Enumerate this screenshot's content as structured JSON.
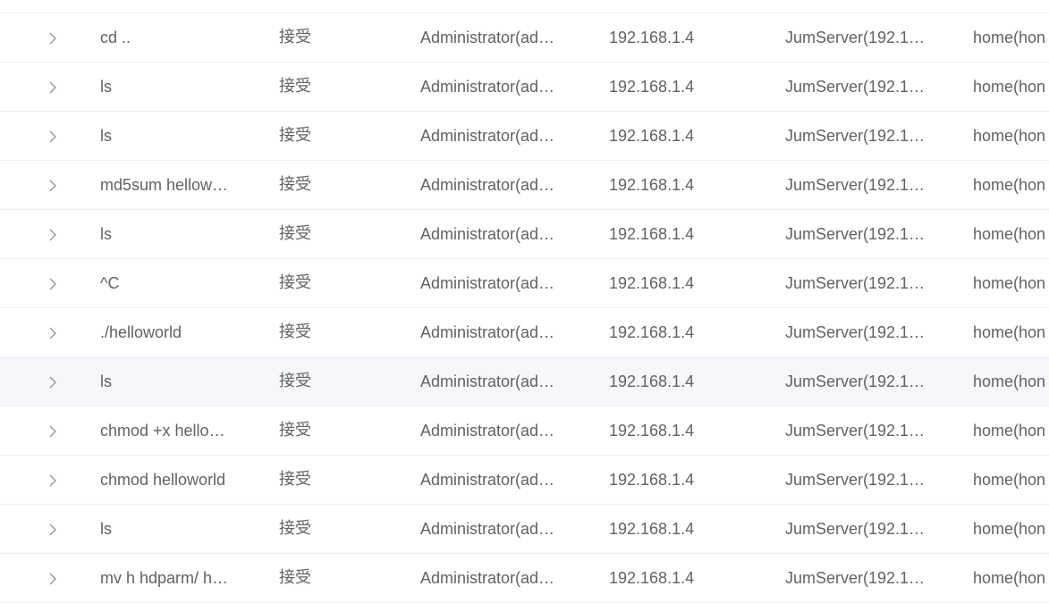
{
  "table": {
    "rows": [
      {
        "command": "",
        "risk": "",
        "user": "",
        "ip": "",
        "asset": "",
        "account": ""
      },
      {
        "command": "cd ..",
        "risk": "接受",
        "user": "Administrator(ad…",
        "ip": "192.168.1.4",
        "asset": "JumServer(192.1…",
        "account": "home(hon"
      },
      {
        "command": "ls",
        "risk": "接受",
        "user": "Administrator(ad…",
        "ip": "192.168.1.4",
        "asset": "JumServer(192.1…",
        "account": "home(hon"
      },
      {
        "command": "ls",
        "risk": "接受",
        "user": "Administrator(ad…",
        "ip": "192.168.1.4",
        "asset": "JumServer(192.1…",
        "account": "home(hon"
      },
      {
        "command": "md5sum hellow…",
        "risk": "接受",
        "user": "Administrator(ad…",
        "ip": "192.168.1.4",
        "asset": "JumServer(192.1…",
        "account": "home(hon"
      },
      {
        "command": "ls",
        "risk": "接受",
        "user": "Administrator(ad…",
        "ip": "192.168.1.4",
        "asset": "JumServer(192.1…",
        "account": "home(hon"
      },
      {
        "command": "^C",
        "risk": "接受",
        "user": "Administrator(ad…",
        "ip": "192.168.1.4",
        "asset": "JumServer(192.1…",
        "account": "home(hon"
      },
      {
        "command": "./helloworld",
        "risk": "接受",
        "user": "Administrator(ad…",
        "ip": "192.168.1.4",
        "asset": "JumServer(192.1…",
        "account": "home(hon"
      },
      {
        "command": "ls",
        "risk": "接受",
        "user": "Administrator(ad…",
        "ip": "192.168.1.4",
        "asset": "JumServer(192.1…",
        "account": "home(hon"
      },
      {
        "command": "chmod +x hello…",
        "risk": "接受",
        "user": "Administrator(ad…",
        "ip": "192.168.1.4",
        "asset": "JumServer(192.1…",
        "account": "home(hon"
      },
      {
        "command": "chmod helloworld",
        "risk": "接受",
        "user": "Administrator(ad…",
        "ip": "192.168.1.4",
        "asset": "JumServer(192.1…",
        "account": "home(hon"
      },
      {
        "command": "ls",
        "risk": "接受",
        "user": "Administrator(ad…",
        "ip": "192.168.1.4",
        "asset": "JumServer(192.1…",
        "account": "home(hon"
      },
      {
        "command": "mv h hdparm/ h…",
        "risk": "接受",
        "user": "Administrator(ad…",
        "ip": "192.168.1.4",
        "asset": "JumServer(192.1…",
        "account": "home(hon"
      }
    ],
    "highlighted_row": 8
  },
  "colors": {
    "text": "#606266",
    "border": "#ebeef5",
    "hover_bg": "#f5f7fa",
    "icon": "#909399"
  }
}
